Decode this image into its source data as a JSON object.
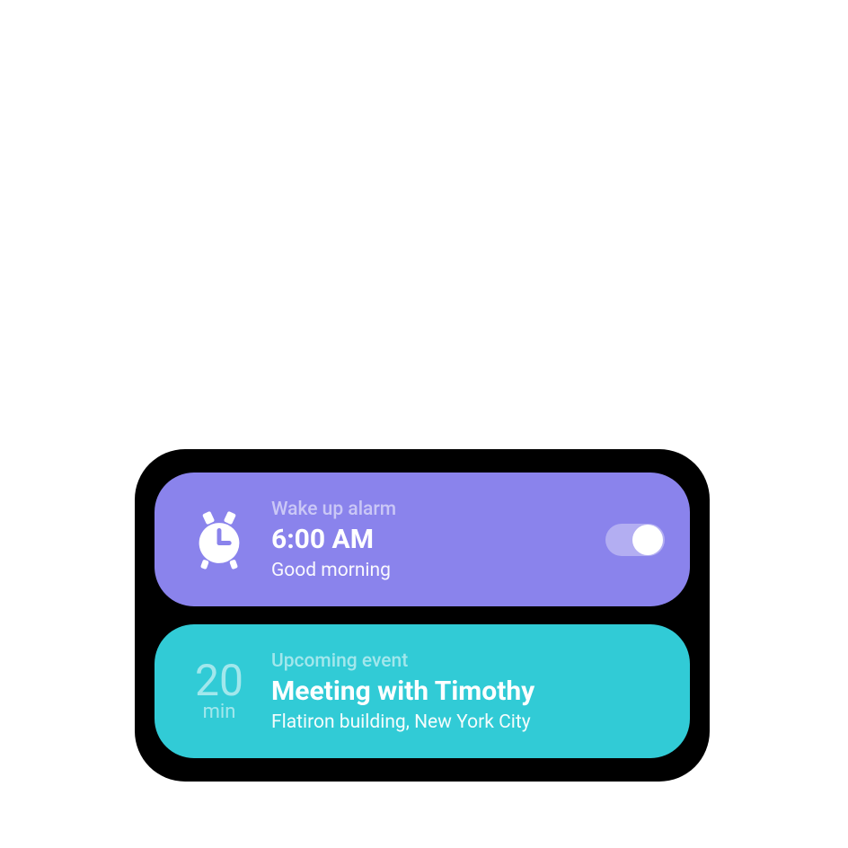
{
  "alarm": {
    "label": "Wake up alarm",
    "time": "6:00 AM",
    "message": "Good morning",
    "toggle_on": true
  },
  "event": {
    "countdown_value": "20",
    "countdown_unit": "min",
    "label": "Upcoming event",
    "title": "Meeting with Timothy",
    "location": "Flatiron building, New York City"
  }
}
